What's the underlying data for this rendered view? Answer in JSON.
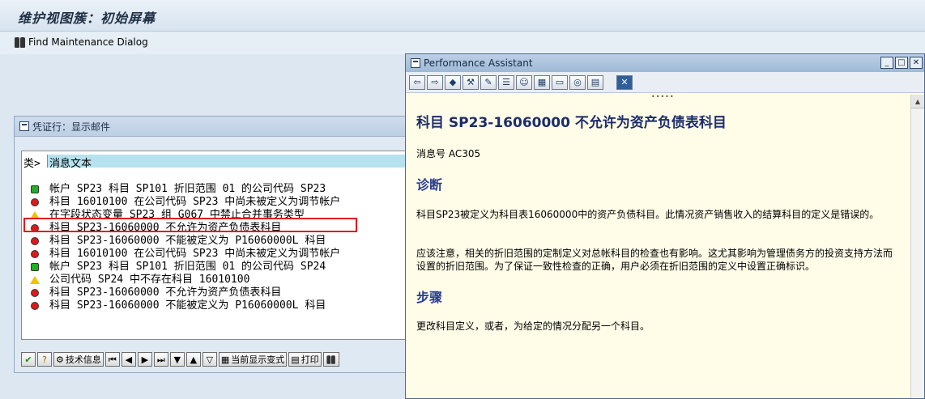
{
  "window": {
    "title": "维护视图簇：初始屏幕",
    "find_label": "Find Maintenance Dialog"
  },
  "dialog": {
    "title": "凭证行：显示邮件",
    "col_type": "类>",
    "col_text": "消息文本",
    "rows": [
      {
        "status": "green",
        "text": "帐户 SP23 科目 SP101 折旧范围 01 的公司代码 SP23"
      },
      {
        "status": "red",
        "text": "科目 16010100 在公司代码 SP23 中尚未被定义为调节帐户"
      },
      {
        "status": "yellow",
        "text": "在字段状态变量 SP23 组 G067 中禁止合并事务类型"
      },
      {
        "status": "red",
        "text": "科目 SP23-16060000 不允许为资产负债表科目"
      },
      {
        "status": "red",
        "text": "科目 SP23-16060000 不能被定义为 P16060000L 科目"
      },
      {
        "status": "red",
        "text": "科目 16010100 在公司代码 SP23 中尚未被定义为调节帐户"
      },
      {
        "status": "green",
        "text": "帐户 SP23 科目 SP101 折旧范围 01 的公司代码 SP24"
      },
      {
        "status": "yellow",
        "text": "公司代码 SP24 中不存在科目 16010100"
      },
      {
        "status": "red",
        "text": "科目 SP23-16060000 不允许为资产负债表科目"
      },
      {
        "status": "red",
        "text": "科目 SP23-16060000 不能被定义为 P16060000L 科目"
      }
    ],
    "toolbar": {
      "tech_info": "技术信息",
      "current_variant": "当前显示变式",
      "print": "打印"
    }
  },
  "assistant": {
    "title": "Performance Assistant",
    "heading": "科目  SP23-16060000 不允许为资产负债表科目",
    "message_no": "消息号  AC305",
    "diag_title": "诊断",
    "diag_p1": "科目SP23被定义为科目表16060000中的资产负债科目。此情况资产销售收入的结算科目的定义是错误的。",
    "diag_p2": "应该注意，相关的折旧范围的定制定义对总帐科目的检查也有影响。这尤其影响为管理债务方的投资支持方法而设置的折旧范围。为了保证一致性检查的正确，用户必须在折旧范围的定义中设置正确标识。",
    "steps_title": "步骤",
    "steps_p": "更改科目定义，或者，为给定的情况分配另一个科目。"
  },
  "colors": {
    "status_green": "#20b020",
    "status_red": "#e01818",
    "status_yellow": "#f2c200",
    "highlight": "#e21b1b",
    "assistant_heading": "#1c2c6b"
  }
}
